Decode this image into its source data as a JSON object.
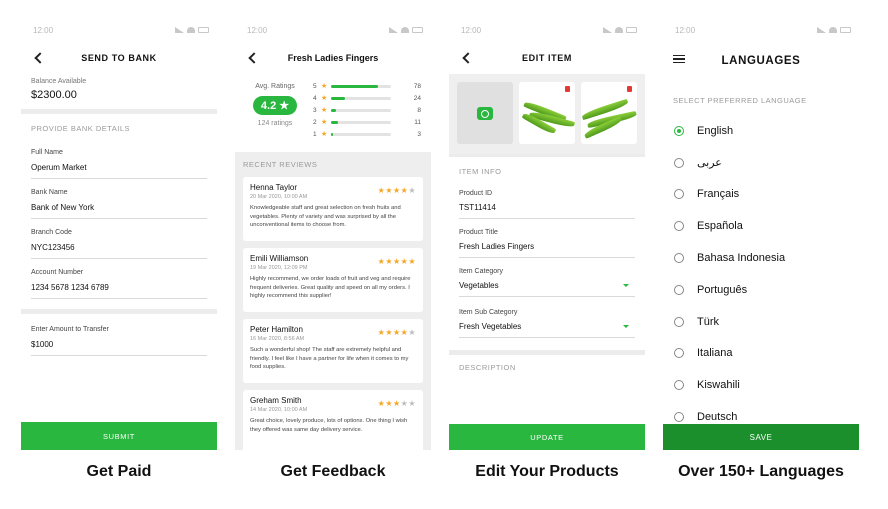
{
  "status_time": "12:00",
  "colors": {
    "accent": "#2ab73f",
    "save_button": "#1b8f2c",
    "star": "#f5a623",
    "delete": "#e53935"
  },
  "screen1": {
    "title": "SEND TO BANK",
    "balance_label": "Balance Available",
    "balance_value": "$2300.00",
    "section": "PROVIDE BANK DETAILS",
    "fields": [
      {
        "label": "Full Name",
        "value": "Operum Market"
      },
      {
        "label": "Bank Name",
        "value": "Bank of New York"
      },
      {
        "label": "Branch Code",
        "value": "NYC123456"
      },
      {
        "label": "Account Number",
        "value": "1234 5678 1234 6789"
      }
    ],
    "amount_label": "Enter Amount to Transfer",
    "amount_value": "$1000",
    "submit": "SUBMIT",
    "caption": "Get Paid"
  },
  "screen2": {
    "title": "Fresh Ladies Fingers",
    "avg_label": "Avg. Ratings",
    "avg_value": "4.2 ★",
    "ratings_count": "124 ratings",
    "star": "★",
    "distribution": [
      {
        "stars": "5",
        "count": "78",
        "fraction": 0.78
      },
      {
        "stars": "4",
        "count": "24",
        "fraction": 0.24
      },
      {
        "stars": "3",
        "count": "8",
        "fraction": 0.08
      },
      {
        "stars": "2",
        "count": "11",
        "fraction": 0.11
      },
      {
        "stars": "1",
        "count": "3",
        "fraction": 0.03
      }
    ],
    "section": "RECENT REVIEWS",
    "reviews": [
      {
        "name": "Henna Taylor",
        "date": "20 Mar 2020, 10:00 AM",
        "rating": 4,
        "text": "Knowledgeable staff and great selection on fresh fruits and vegetables. Plenty of variety and was surprised by all the unconventional items to choose from."
      },
      {
        "name": "Emili Williamson",
        "date": "19 Mar 2020, 12:09 PM",
        "rating": 5,
        "text": "Highly recommend, we order loads of fruit and veg and require frequent deliveries. Great quality and speed on all my orders. I highly recommend this supplier!"
      },
      {
        "name": "Peter Hamilton",
        "date": "16 Mar 2020, 8:56 AM",
        "rating": 4,
        "text": "Such a wonderful shop! The staff are extremely helpful and friendly. I feel like I have a partner for life when it comes to my food supplies."
      },
      {
        "name": "Greham Smith",
        "date": "14 Mar 2020, 10:00 AM",
        "rating": 3,
        "text": "Great choice, lovely produce, lots of options. One thing I wish they offered was same day delivery service."
      }
    ],
    "caption": "Get Feedback"
  },
  "screen3": {
    "title": "EDIT ITEM",
    "section": "ITEM INFO",
    "fields": [
      {
        "label": "Product ID",
        "value": "TST11414"
      },
      {
        "label": "Product Title",
        "value": "Fresh Ladies Fingers"
      },
      {
        "label": "Item Category",
        "value": "Vegetables"
      },
      {
        "label": "Item Sub Category",
        "value": "Fresh Vegetables"
      }
    ],
    "description_label": "DESCRIPTION",
    "update": "UPDATE",
    "caption": "Edit Your Products"
  },
  "screen4": {
    "title": "LANGUAGES",
    "section": "SELECT PREFERRED LANGUAGE",
    "languages": [
      "English",
      "عربى",
      "Français",
      "Española",
      "Bahasa Indonesia",
      "Português",
      "Türk",
      "Italiana",
      "Kiswahili",
      "Deutsch"
    ],
    "selected": "English",
    "save": "SAVE",
    "caption": "Over 150+ Languages"
  }
}
